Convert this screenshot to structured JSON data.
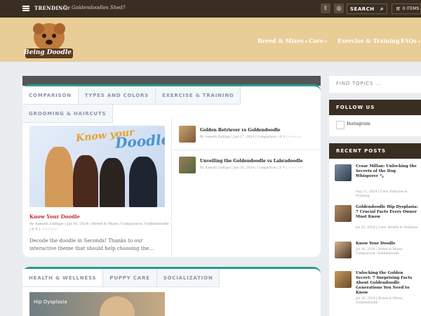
{
  "topbar": {
    "trending_label": "TRENDING:",
    "trending_text": "Do Goldendoodles Shed?",
    "search_label": "SEARCH",
    "cart_label": "0 ITEMS"
  },
  "header": {
    "logo_text": "Being Doodle",
    "nav": [
      {
        "label": "Breed & Mixes"
      },
      {
        "label": "Care"
      },
      {
        "label": "Exercise & Training"
      },
      {
        "label": "FAQs"
      }
    ]
  },
  "section1": {
    "tabs": [
      "COMPARISON",
      "TYPES AND COLORS",
      "EXERCISE & TRAINING",
      "GROOMING & HAIRCUTS"
    ],
    "image_text": {
      "know": "Know your",
      "doodle": "Doodle"
    },
    "feature": {
      "title": "Know Your Doodle",
      "meta": "By Aamish Zulfiqar | Jul 16, 2024 | Breed & Mixes, Comparison, Goldendoodle | 0 ✎ | ☆☆☆☆☆",
      "excerpt": "Decode the doodle in Seconds! Thanks to our interactive theme that should help choosing the..."
    },
    "side_posts": [
      {
        "title": "Golden Retriever vs Goldendoodle",
        "meta": "By Aamish Zulfiqar | Jun 17, 2024 | Comparison | 0 ✎ | ☆☆☆☆☆"
      },
      {
        "title": "Unveiling the Goldendoodle vs Labradoodle",
        "meta": "By Aamish Zulfiqar | Jun 16, 2024 | Comparison | 0 ✎ | ☆☆☆☆☆"
      }
    ]
  },
  "section2": {
    "tabs": [
      "HEALTH & WELLNESS",
      "PUPPY CARE",
      "SOCIALIZATION"
    ],
    "image_text": "Hip Dysplasia"
  },
  "sidebar": {
    "find_topics": "FIND TOPICS ...",
    "follow_heading": "FOLLOW US",
    "instagram": "Instagram",
    "recent_heading": "RECENT POSTS",
    "recent_posts": [
      {
        "title": "Cesar Millan: Unlocking the Secrets of the Dog Whisperer 🐾",
        "meta": "Aug 11, 2024 | Care, Exercise & Training"
      },
      {
        "title": "Goldendoodle Hip Dysplasia: 7 Crucial Facts Every Owner Must Know",
        "meta": "Jul 25, 2024 | Care, Health & Wellness"
      },
      {
        "title": "Know Your Doodle",
        "meta": "Jul 16, 2024 | Breed & Mixes, Comparison, Goldendoodle"
      },
      {
        "title": "Unlocking the Golden Secret: 7 Surprising Facts About Goldendoodle Generations You Need to Know",
        "meta": "Jul 16, 2024 | Breed & Mixes, Goldendoodle"
      }
    ]
  },
  "colors": {
    "topbar": "#3a2e22",
    "header": "#e9cd97",
    "accent_teal": "#2a9a8c",
    "link_red": "#c02e2e"
  }
}
